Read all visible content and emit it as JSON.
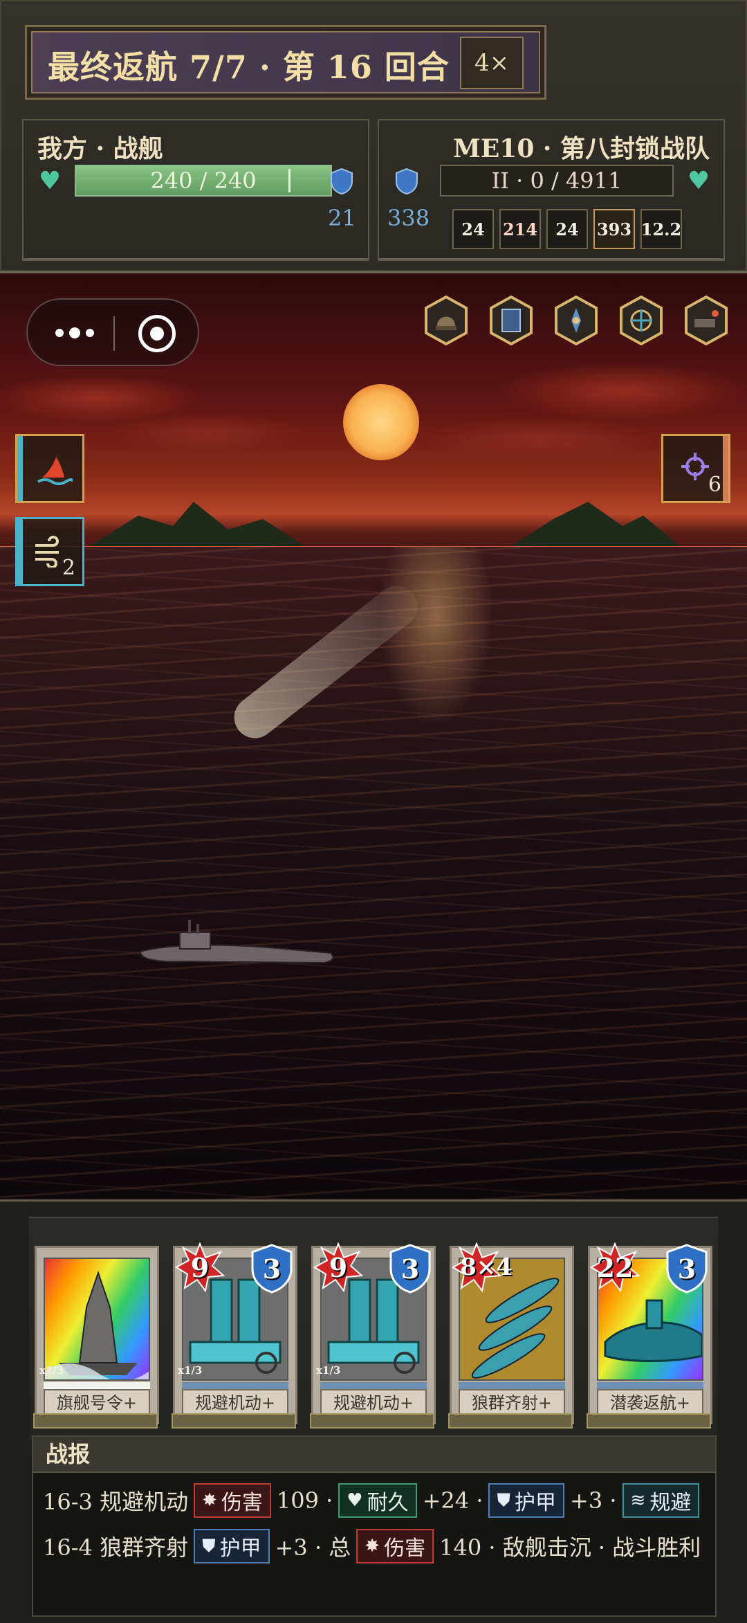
{
  "header": {
    "title": "最终返航 7/7 · 第 16 回合",
    "speed": "4×"
  },
  "player": {
    "name": "我方 · 战舰",
    "hp_text": "240 / 240",
    "hp_fraction": 1.0,
    "armor": "21"
  },
  "enemy": {
    "name": "ME10 · 第八封锁战队",
    "hp_text": "II · 0 / 4911",
    "armor": "338",
    "intents": [
      {
        "value": "24",
        "icon": "anchor-icon"
      },
      {
        "value": "214",
        "icon": "burst-icon"
      },
      {
        "value": "24",
        "icon": "anchor-icon"
      },
      {
        "value": "393",
        "icon": "shield-icon"
      },
      {
        "value": "12.2",
        "icon": "crate-icon"
      }
    ]
  },
  "relics": [
    "helmet-relic-icon",
    "armor-plate-relic-icon",
    "crest-relic-icon",
    "compass-relic-icon",
    "cannon-relic-icon"
  ],
  "status_effects": {
    "player": [
      {
        "icon": "shark-fin-icon",
        "count": ""
      },
      {
        "icon": "wind-icon",
        "count": "2"
      }
    ],
    "enemy": [
      {
        "icon": "crosshair-icon",
        "count": "6"
      }
    ]
  },
  "hand": [
    {
      "name": "旗舰号令+",
      "tier": "x1/3",
      "damage": "",
      "shield": "",
      "art": "battleship"
    },
    {
      "name": "规避机动+",
      "tier": "x1/3",
      "damage": "9",
      "shield": "3",
      "art": "engine"
    },
    {
      "name": "规避机动+",
      "tier": "x1/3",
      "damage": "9",
      "shield": "3",
      "art": "engine"
    },
    {
      "name": "狼群齐射+",
      "tier": "",
      "damage": "8×4",
      "shield": "",
      "art": "torpedoes"
    },
    {
      "name": "潜袭返航+",
      "tier": "",
      "damage": "22",
      "shield": "3",
      "art": "submarine"
    }
  ],
  "report": {
    "title": "战报",
    "line1": {
      "prefix": "16-3 规避机动",
      "damage_label": "伤害",
      "damage_value": "109 ·",
      "hp_label": "耐久",
      "hp_value": "+24 ·",
      "armor_label": "护甲",
      "armor_value": "+3 ·",
      "evade_label": "规避"
    },
    "line2": {
      "prefix": "16-4 狼群齐射",
      "armor_label": "护甲",
      "armor_value": "+3 · 总",
      "damage_label": "伤害",
      "damage_value": "140 · 敌舰击沉 · 战斗胜利"
    }
  },
  "colors": {
    "hp_green": "#5f9c5f",
    "heart_teal": "#4fc7a1",
    "armor_blue": "#4f7fb5",
    "damage_red": "#c53a34",
    "title_gold": "#f3dfa6"
  }
}
